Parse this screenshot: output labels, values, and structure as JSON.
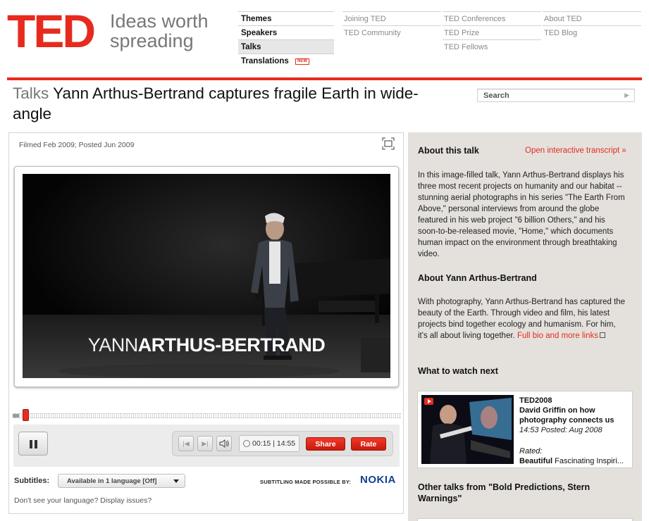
{
  "brand": {
    "logo": "TED",
    "tagline_line1": "Ideas worth",
    "tagline_line2": "spreading",
    "accent": "#e62b1e"
  },
  "main_nav": [
    {
      "label": "Themes",
      "active": false
    },
    {
      "label": "Speakers",
      "active": false
    },
    {
      "label": "Talks",
      "active": true
    },
    {
      "label": "Translations",
      "active": false,
      "badge": "NEW"
    }
  ],
  "sub_nav": {
    "col1": [
      "Joining TED",
      "TED Community"
    ],
    "col2": [
      "TED Conferences",
      "TED Prize",
      "TED Fellows"
    ],
    "col3": [
      "About TED",
      "TED Blog"
    ]
  },
  "page": {
    "kicker": "Talks",
    "title": "Yann Arthus-Bertrand captures fragile Earth in wide-angle"
  },
  "search": {
    "placeholder": "Search",
    "go_icon": "triangle-right-icon"
  },
  "player": {
    "filmed": "Filmed Feb 2009; Posted Jun 2009",
    "fullscreen_icon": "fullscreen-icon",
    "overlay_first": "YANN",
    "overlay_last": "ARTHUS-BERTRAND",
    "progress_fraction": 0.017,
    "time_current": "00:15",
    "time_separator": "|",
    "time_total": "14:55",
    "share_label": "Share",
    "rate_label": "Rate",
    "controls_icons": [
      "pause-icon",
      "previous-icon",
      "next-icon",
      "volume-icon",
      "clock-icon"
    ]
  },
  "subtitles": {
    "label": "Subtitles:",
    "selected": "Available in 1 language [Off]",
    "sponsor_text": "SUBTITLING MADE POSSIBLE BY:",
    "sponsor_name": "NOKIA",
    "help_text": "Don't see your language? Display issues?"
  },
  "sidebar": {
    "about_talk_heading": "About this talk",
    "transcript_link": "Open interactive transcript »",
    "about_talk_text": "In this image-filled talk, Yann Arthus-Bertrand displays his three most recent projects on humanity and our habitat -- stunning aerial photographs in his series \"The Earth From Above,\" personal interviews from around the globe featured in his web project \"6 billion Others,\" and his soon-to-be-released movie, \"Home,\" which documents human impact on the environment through breathtaking video.",
    "about_speaker_heading": "About Yann Arthus-Bertrand",
    "about_speaker_text": "With photography, Yann Arthus-Bertrand has captured the beauty of the Earth. Through video and film, his latest projects bind together ecology and humanism. For him, it's all about living together.",
    "bio_link": "Full bio and more links",
    "watch_next_heading": "What to watch next",
    "next": {
      "event": "TED2008",
      "title": "David Griffin on how photography connects us",
      "meta": "14:53 Posted: Aug 2008",
      "rated_label": "Rated:",
      "rated_tag": "Beautiful",
      "rated_rest": "Fascinating Inspiri..."
    },
    "other_talks_heading": "Other talks from \"Bold Predictions, Stern Warnings\""
  }
}
